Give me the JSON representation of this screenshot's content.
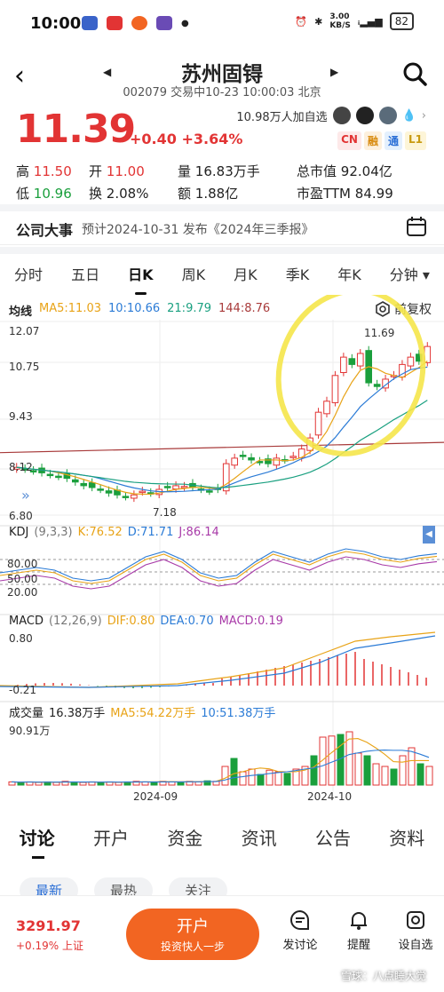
{
  "status_bar": {
    "time": "10:00",
    "net_speed": "3.00\nKB/S",
    "battery": "82"
  },
  "header": {
    "title": "苏州固锝",
    "subtitle": "002079 交易中10-23 10:00:03 北京"
  },
  "quote": {
    "price": "11.39",
    "change": "+0.40 +3.64%",
    "followers": "10.98万人加自选",
    "tags": [
      "CN",
      "融",
      "通",
      "L1"
    ],
    "stats": [
      [
        {
          "l": "高",
          "v": "11.50",
          "c": "red"
        },
        {
          "l": "开",
          "v": "11.00",
          "c": "red"
        },
        {
          "l": "量",
          "v": "16.83万手",
          "c": ""
        },
        {
          "l": "总市值",
          "v": "92.04亿",
          "c": ""
        }
      ],
      [
        {
          "l": "低",
          "v": "10.96",
          "c": "green"
        },
        {
          "l": "换",
          "v": "2.08%",
          "c": ""
        },
        {
          "l": "额",
          "v": "1.88亿",
          "c": ""
        },
        {
          "l": "市盈TTM",
          "v": "84.99",
          "c": ""
        }
      ]
    ]
  },
  "event": {
    "title": "公司大事",
    "desc": "预计2024-10-31 发布《2024年三季报》"
  },
  "period_tabs": [
    "分时",
    "五日",
    "日K",
    "周K",
    "月K",
    "季K",
    "年K",
    "分钟 ▾"
  ],
  "active_period": "日K",
  "ma_legend": {
    "label": "均线",
    "ma5": "MA5:11.03",
    "ma10": "10:10.66",
    "ma21": "21:9.79",
    "ma144": "144:8.76"
  },
  "adjust_label": "前复权",
  "price_axis": [
    "12.07",
    "10.75",
    "9.43",
    "8.12",
    "6.80"
  ],
  "high_label": "11.69",
  "low_label": "7.18",
  "kdj": {
    "label": "KDJ",
    "params": "(9,3,3)",
    "k": "K:76.52",
    "d": "D:71.71",
    "j": "J:86.14",
    "axis": [
      "80.00",
      "50.00",
      "20.00"
    ]
  },
  "macd": {
    "label": "MACD",
    "params": "(12,26,9)",
    "dif": "DIF:0.80",
    "dea": "DEA:0.70",
    "macd": "MACD:0.19",
    "axis": [
      "0.80",
      "-0.21"
    ]
  },
  "volume": {
    "label": "成交量",
    "total": "16.38万手",
    "ma5": "MA5:54.22万手",
    "ma10": "10:51.38万手",
    "axis": "90.91万"
  },
  "date_axis": [
    "2024-09",
    "2024-10"
  ],
  "colors": {
    "up": "#e23434",
    "down": "#1a9f3c",
    "ma5": "#e8a317",
    "ma10": "#2b7bd6",
    "ma21": "#1aa080",
    "ma144": "#a83a3a",
    "highlight": "#f5e64a"
  },
  "bottom_tabs": [
    "讨论",
    "开户",
    "资金",
    "资讯",
    "公告",
    "资料"
  ],
  "pills": [
    "最新",
    "最热",
    "关注"
  ],
  "footer": {
    "index_value": "3291.97",
    "index_change": "+0.19% 上证",
    "trade_label": "开户",
    "trade_sub": "投资快人一步",
    "buttons": [
      "发讨论",
      "提醒",
      "设自选"
    ]
  },
  "watermark": "雪球：八点睡大觉"
}
